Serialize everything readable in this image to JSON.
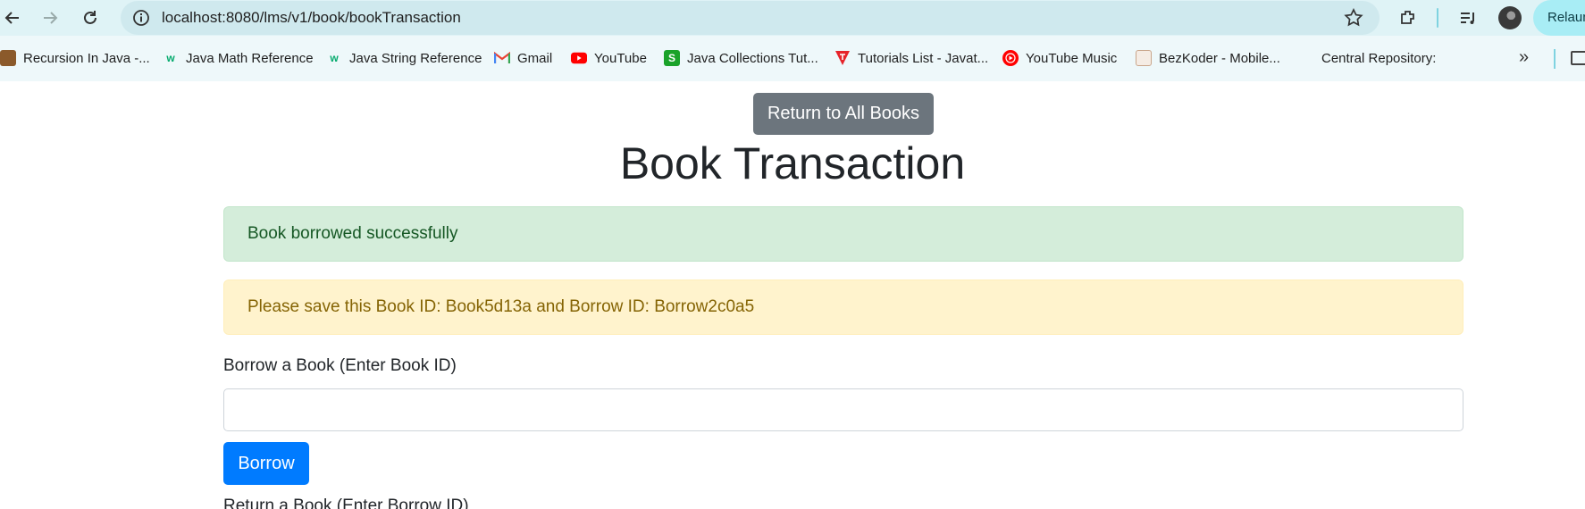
{
  "browser": {
    "url": "localhost:8080/lms/v1/book/bookTransaction",
    "relaunch_label": "Relaunch"
  },
  "bookmarks": [
    {
      "label": "Recursion In Java -...",
      "icon": "book-icon"
    },
    {
      "label": "Java Math Reference",
      "icon": "w3schools-icon"
    },
    {
      "label": "Java String Reference",
      "icon": "w3schools-icon"
    },
    {
      "label": "Gmail",
      "icon": "gmail-icon"
    },
    {
      "label": "YouTube",
      "icon": "youtube-icon"
    },
    {
      "label": "Java Collections Tut...",
      "icon": "s-icon"
    },
    {
      "label": "Tutorials List - Javat...",
      "icon": "javatpoint-icon"
    },
    {
      "label": "YouTube Music",
      "icon": "youtube-music-icon"
    },
    {
      "label": "BezKoder - Mobile...",
      "icon": "bezkoder-icon"
    },
    {
      "label": "Central Repository:",
      "icon": ""
    }
  ],
  "page": {
    "return_button": "Return to All Books",
    "title": "Book Transaction",
    "alert_success": "Book borrowed successfully",
    "alert_warning": "Please save this Book ID: Book5d13a and Borrow ID: Borrow2c0a5",
    "borrow_label": "Borrow a Book (Enter Book ID)",
    "borrow_input_value": "",
    "borrow_button": "Borrow",
    "return_label": "Return a Book (Enter Borrow ID)"
  },
  "colors": {
    "secondary": "#6c757d",
    "primary": "#007bff",
    "success_bg": "#d4edda",
    "warning_bg": "#fff3cd"
  }
}
